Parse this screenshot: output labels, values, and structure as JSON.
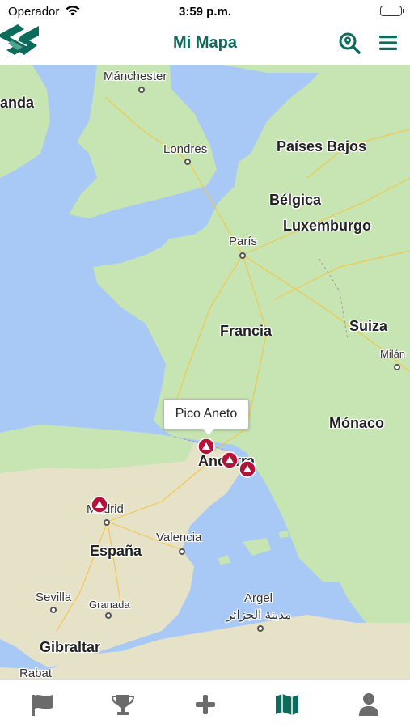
{
  "status_bar": {
    "carrier": "Operador",
    "time": "3:59 p.m."
  },
  "navbar": {
    "title": "Mi Mapa",
    "brand_color": "#0d6b5c"
  },
  "map": {
    "labels": {
      "irlanda": "anda",
      "manchester": "Mánchester",
      "londres": "Londres",
      "paises_bajos": "Países Bajos",
      "belgica": "Bélgica",
      "luxemburgo": "Luxemburgo",
      "paris": "París",
      "francia": "Francia",
      "suiza": "Suiza",
      "milan": "Milán",
      "monaco": "Mónaco",
      "andorra": "Andorra",
      "madrid": "Madrid",
      "espana": "España",
      "valencia": "Valencia",
      "sevilla": "Sevilla",
      "granada": "Granada",
      "gibraltar": "Gibraltar",
      "argel": "Argel",
      "argel_arabic": "مدينة الجزائر",
      "rabat": "Rabat"
    },
    "callout": "Pico Aneto",
    "pin_color": "#b5123a",
    "water_color": "#a8c8f5",
    "land_color": "#c6e5b2"
  },
  "tabbar": {
    "tabs": [
      "flag-icon",
      "trophy-icon",
      "plus-icon",
      "map-icon",
      "user-icon"
    ],
    "active": "map-icon",
    "active_color": "#0d6b5c",
    "inactive_color": "#6b6b6b"
  }
}
